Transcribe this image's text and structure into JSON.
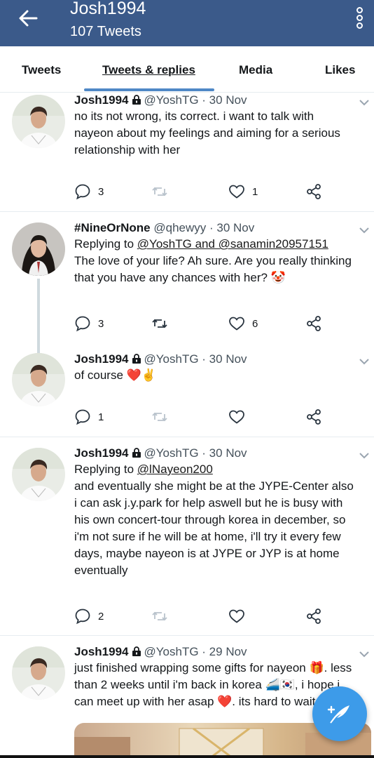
{
  "header": {
    "title": "Josh1994",
    "subtitle": "107 Tweets"
  },
  "tabs": [
    "Tweets",
    "Tweets & replies",
    "Media",
    "Likes"
  ],
  "tweets": [
    {
      "name": "Josh1994",
      "handle": "@YoshTG",
      "date": "· 30 Nov",
      "text": "no its not wrong, its correct. i want to talk with nayeon about my feelings and aiming for a serious relationship with her",
      "replies": "3",
      "retweets": "",
      "likes": "1"
    },
    {
      "name": "#NineOrNone",
      "handle": "@qhewyy",
      "date": "· 30 Nov",
      "replying_prefix": "Replying to",
      "replying_to": "@YoshTG and @sanamin20957151",
      "text": "The love of your life? Ah sure. Are you really thinking that you have any chances with her? 🤡",
      "replies": "3",
      "retweets": "",
      "likes": "6"
    },
    {
      "name": "Josh1994",
      "handle": "@YoshTG",
      "date": "· 30 Nov",
      "text": "of course ❤️✌️",
      "replies": "1",
      "retweets": "",
      "likes": ""
    },
    {
      "name": "Josh1994",
      "handle": "@YoshTG",
      "date": "· 30 Nov",
      "replying_prefix": "Replying to",
      "replying_to": "@lNayeon200",
      "text": "and eventually she might be at the JYPE-Center also i can ask j.y.park for help aswell but he is busy with his own concert-tour through korea in december, so i'm not sure if he will be at home, i'll try it every few days, maybe nayeon is at JYPE or JYP is at home eventually",
      "replies": "2",
      "retweets": "",
      "likes": ""
    },
    {
      "name": "Josh1994",
      "handle": "@YoshTG",
      "date": "· 29 Nov",
      "text": "just finished wrapping some gifts for nayeon 🎁. less than 2 weeks until i'm back in korea 🚄🇰🇷, i hope i can meet up with her asap ❤️. its hard to wait"
    }
  ],
  "colors": {
    "header_bg": "#3b5a8a",
    "accent": "#4f88c6",
    "fab": "#3d9be9",
    "icon": "#8899a6"
  }
}
